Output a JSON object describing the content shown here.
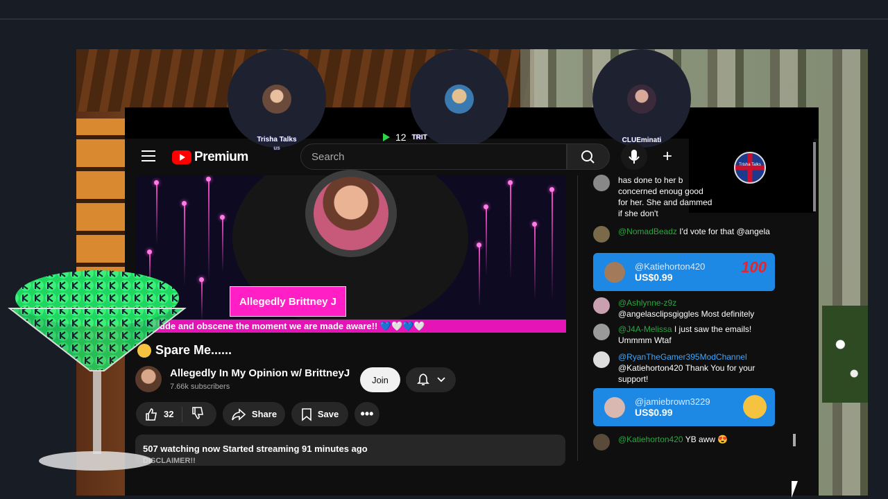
{
  "header": {
    "logo_text": "Premium",
    "search_placeholder": "Search",
    "create_label": "+"
  },
  "participants": [
    {
      "name": "Trisha Talks",
      "sub": "us"
    },
    {
      "name": "TRIT"
    },
    {
      "name": "CLUEminati"
    }
  ],
  "viewer_count": "12",
  "overlay": {
    "flag_label": "Trisha Talks"
  },
  "stream": {
    "name_badge": "Allegedly Brittney J",
    "ticker": "ude and obscene the moment we are made aware!! 💙🤍💙🤍",
    "title": "Spare Me......",
    "channel_name": "Allegedly In My Opinion w/ BrittneyJ",
    "subscribers": "7.66k subscribers",
    "join_label": "Join",
    "likes": "32",
    "share_label": "Share",
    "save_label": "Save",
    "more_label": "•••",
    "watching": "507 watching now",
    "started": "Started streaming 91 minutes ago",
    "disclaimer": "DISCLAIMER!!"
  },
  "chat": {
    "partial_message": "has done to her b concerned enoug good for her. She and dammed if she don't",
    "messages": [
      {
        "author": "@NomadBeadz",
        "text": "I'd vote for that @angela"
      },
      {
        "author": "@Ashlynne-z9z",
        "text": "@angelasclipsgiggles Most definitely"
      },
      {
        "author": "@J4A-Melissa",
        "text": "I just saw the emails! Ummmm Wtaf"
      },
      {
        "author": "@RyanTheGamer395ModChannel",
        "text": "@Katiehorton420 Thank You for your support!"
      },
      {
        "author": "@Katiehorton420",
        "text": "YB aww 😍"
      }
    ],
    "superchats": [
      {
        "author": "@Katiehorton420",
        "amount": "US$0.99",
        "sticker": "100"
      },
      {
        "author": "@jamiebrown3229",
        "amount": "US$0.99"
      }
    ]
  },
  "colors": {
    "youtube_red": "#ff0000",
    "superchat_blue": "#1e88e5",
    "ticker_pink": "#e414b6",
    "chat_author_green": "#2ba640"
  }
}
